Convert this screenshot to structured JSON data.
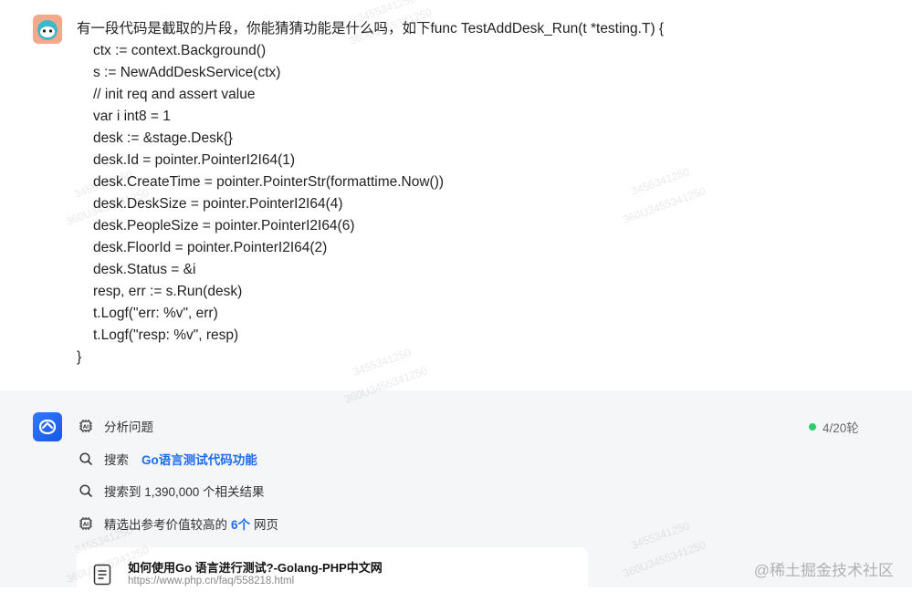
{
  "user_message": {
    "lines": [
      "有一段代码是截取的片段，你能猜猜功能是什么吗，如下func TestAddDesk_Run(t *testing.T) {",
      "ctx := context.Background()",
      "s := NewAddDeskService(ctx)",
      "// init req and assert value",
      "var i int8 = 1",
      "desk := &stage.Desk{}",
      "desk.Id = pointer.PointerI2I64(1)",
      "desk.CreateTime = pointer.PointerStr(formattime.Now())",
      "desk.DeskSize = pointer.PointerI2I64(4)",
      "desk.PeopleSize = pointer.PointerI2I64(6)",
      "desk.FloorId = pointer.PointerI2I64(2)",
      "desk.Status = &i",
      "resp, err := s.Run(desk)",
      "t.Logf(\"err: %v\", err)",
      "t.Logf(\"resp: %v\", resp)",
      "}"
    ]
  },
  "ai": {
    "round_status": "4/20轮",
    "status_color": "#2ecc71",
    "steps": {
      "analyze": "分析问题",
      "search_prefix": "搜索",
      "search_query": "Go语言测试代码功能",
      "results_found": "搜索到 1,390,000 个相关结果",
      "select_prefix": "精选出参考价值较高的",
      "select_count": "6个",
      "select_suffix": "网页"
    },
    "result_card": {
      "title": "如何使用Go 语言进行测试?-Golang-PHP中文网",
      "url": "https://www.php.cn/faq/558218.html"
    }
  },
  "brand": "@稀土掘金技术社区",
  "watermark": {
    "line1": "3455341250",
    "line2": "360U3455341250"
  },
  "colors": {
    "accent": "#1d6cf0",
    "panel_bg": "#f5f6f8"
  },
  "icons": {
    "user_avatar": "cartoon-face-icon",
    "ai_avatar": "ai-assistant-logo-icon",
    "analyze": "ai-chip-icon",
    "search": "search-icon",
    "select": "ai-chip-icon",
    "doc": "document-icon"
  }
}
